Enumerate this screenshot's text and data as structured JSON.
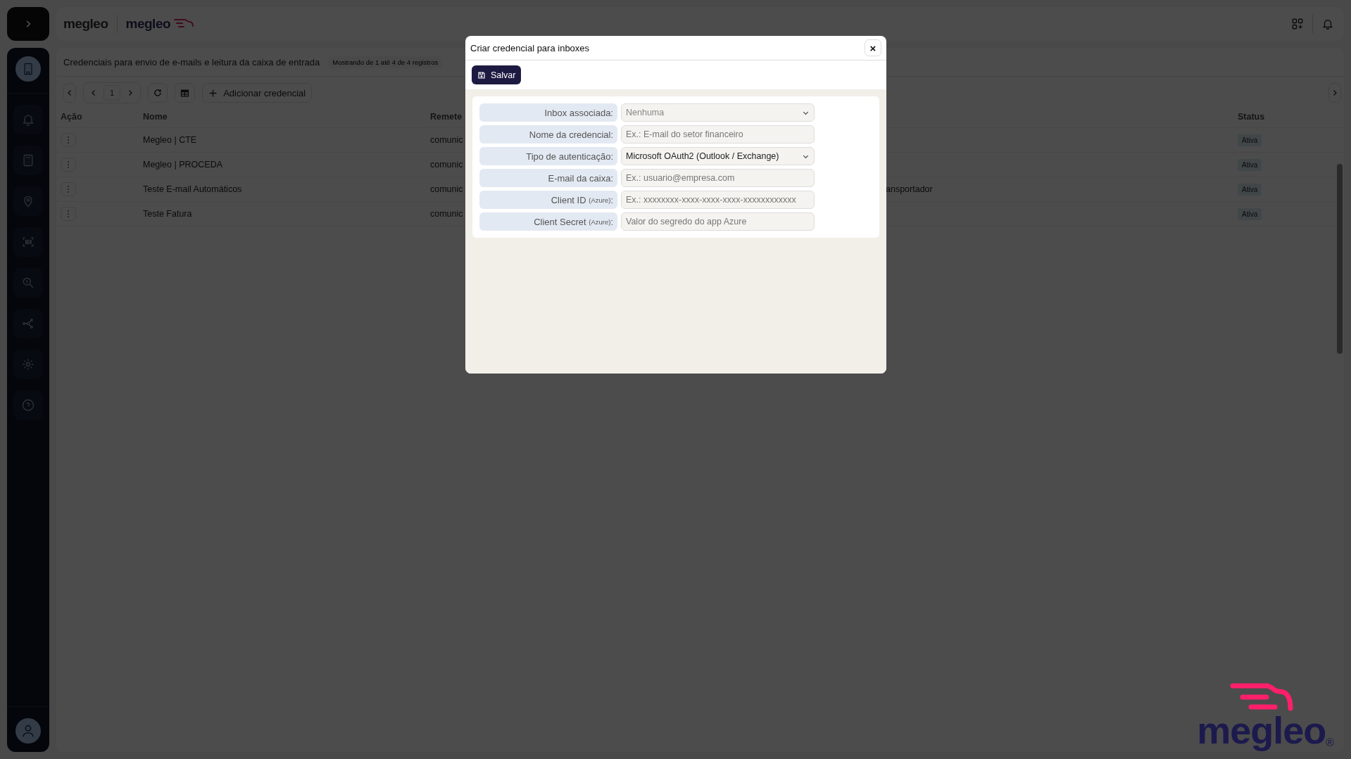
{
  "header": {
    "brands": [
      "megleo",
      "megleo"
    ]
  },
  "sidebar": {
    "items": [
      {
        "selected": true
      },
      {
        "selected": false
      },
      {
        "selected": false
      },
      {
        "selected": false
      },
      {
        "selected": false
      },
      {
        "selected": false
      },
      {
        "selected": false
      },
      {
        "selected": false
      },
      {
        "selected": false
      }
    ]
  },
  "card": {
    "title": "Credenciais para envio de e-mails e leitura da caixa de entrada",
    "count": "Mostrando de 1 até 4 de 4 registros"
  },
  "toolbar": {
    "page": "1",
    "add_label": "Adicionar credencial"
  },
  "table": {
    "columns": [
      "Ação",
      "Nome",
      "Remete",
      "Status"
    ],
    "rows": [
      {
        "name": "Megleo | CTE",
        "column_3": "comunic",
        "status": "Ativa"
      },
      {
        "name": "Megleo | PROCEDA",
        "column_3": "comunic",
        "status": "Ativa"
      },
      {
        "name": "Teste E-mail Automáticos",
        "column_3": "comunic",
        "column_4": "ansportador",
        "status": "Ativa"
      },
      {
        "name": "Teste Fatura",
        "column_3": "comunic",
        "status": "Ativa"
      }
    ]
  },
  "modal": {
    "title": "Criar credencial para inboxes",
    "close": "×",
    "save": "Salvar",
    "fields": [
      {
        "label": "Inbox associada:",
        "kind": "select",
        "placeholder": "Nenhuma"
      },
      {
        "label": "Nome da credencial:",
        "kind": "input",
        "placeholder": "Ex.: E-mail do setor financeiro"
      },
      {
        "label": "Tipo de autenticação:",
        "kind": "select",
        "value": "Microsoft OAuth2 (Outlook / Exchange)"
      },
      {
        "label": "E-mail da caixa:",
        "kind": "input",
        "placeholder": "Ex.: usuario@empresa.com"
      },
      {
        "label": "Client ID",
        "note": "(Azure)",
        "label_end": ":",
        "kind": "input",
        "placeholder": "Ex.: xxxxxxxx-xxxx-xxxx-xxxx-xxxxxxxxxxxx"
      },
      {
        "label": "Client Secret",
        "note": "(Azure)",
        "label_end": ":",
        "kind": "input",
        "placeholder": "Valor do segredo do app Azure"
      }
    ]
  },
  "corner_logo": {
    "text": "megleo",
    "mark": "®"
  }
}
